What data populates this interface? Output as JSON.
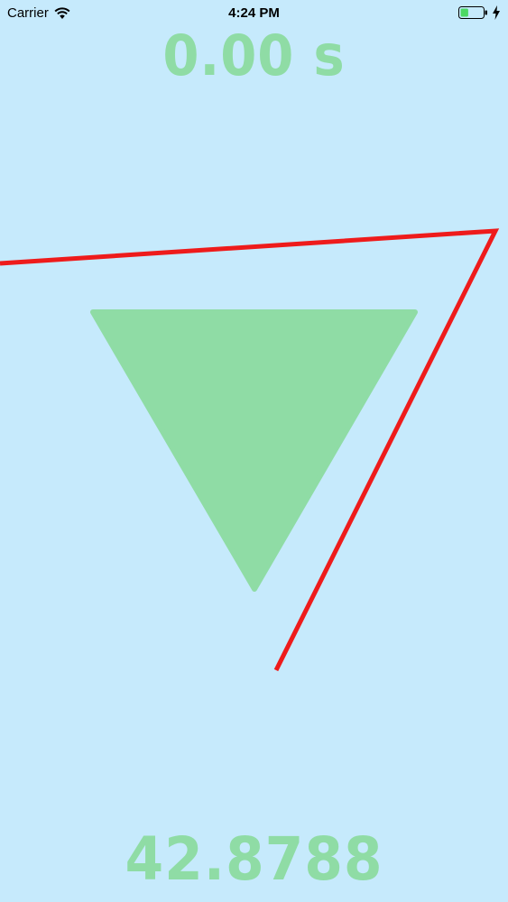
{
  "status_bar": {
    "carrier": "Carrier",
    "time": "4:24 PM",
    "wifi_icon": "wifi-icon",
    "battery_icon": "battery-icon",
    "charging_icon": "charging-bolt-icon",
    "battery_level": 0.35
  },
  "game": {
    "timer": "0.00 s",
    "score": "42.8788",
    "shape": "triangle-pointing-down"
  },
  "colors": {
    "background": "#c6eafc",
    "accent": "#8fdca5",
    "trace_line": "#ee1b1b",
    "battery_fill": "#4cd964"
  }
}
